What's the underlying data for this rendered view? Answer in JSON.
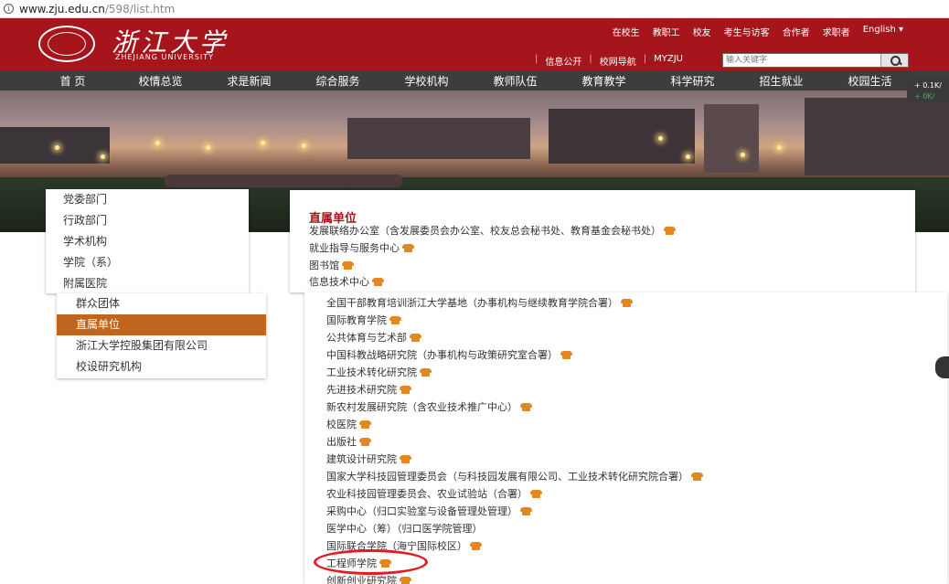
{
  "address_bar": {
    "host": "www.zju.edu.cn",
    "path": "/598/list.htm"
  },
  "header": {
    "logo_cn": "浙江大学",
    "logo_en": "ZHEJIANG UNIVERSITY",
    "top_links": [
      "在校生",
      "教职工",
      "校友",
      "考生与访客",
      "合作者",
      "求职者",
      "English ▾"
    ],
    "sub_links": [
      "信息公开",
      "校网导航",
      "MYZJU"
    ],
    "search_placeholder": "输入关键字"
  },
  "nav": [
    "首 页",
    "校情总览",
    "求是新闻",
    "综合服务",
    "学校机构",
    "教师队伍",
    "教育教学",
    "科学研究",
    "招生就业",
    "校园生活"
  ],
  "stock": {
    "line1": "+ 0.1K/",
    "line2": "+ 0K/"
  },
  "left_menu_top": [
    "党委部门",
    "行政部门",
    "学术机构",
    "学院（系）",
    "附属医院"
  ],
  "left_menu_bottom": [
    {
      "label": "群众团体",
      "active": false
    },
    {
      "label": "直属单位",
      "active": true
    },
    {
      "label": "浙江大学控股集团有限公司",
      "active": false
    },
    {
      "label": "校设研究机构",
      "active": false
    }
  ],
  "content": {
    "title": "直属单位",
    "units_top": [
      "发展联络办公室（含发展委员会办公室、校友总会秘书处、教育基金会秘书处）",
      "就业指导与服务中心",
      "图书馆",
      "信息技术中心"
    ],
    "units_bottom": [
      "全国干部教育培训浙江大学基地（办事机构与继续教育学院合署）",
      "国际教育学院",
      "公共体育与艺术部",
      "中国科教战略研究院（办事机构与政策研究室合署）",
      "工业技术转化研究院",
      "先进技术研究院",
      "新农村发展研究院（含农业技术推广中心）",
      "校医院",
      "出版社",
      "建筑设计研究院",
      "国家大学科技园管理委员会（与科技园发展有限公司、工业技术转化研究院合署）",
      "农业科技园管理委员会、农业试验站（合署）",
      "采购中心（归口实验室与设备管理处管理）",
      "医学中心（筹）（归口医学院管理）",
      "国际联合学院（海宁国际校区）",
      "工程师学院",
      "创新创业研究院"
    ]
  },
  "colors": {
    "brand_red": "#a5151b",
    "active_orange": "#c0651d",
    "phone_icon": "#e4871e",
    "annotation_red": "#e31b23"
  }
}
